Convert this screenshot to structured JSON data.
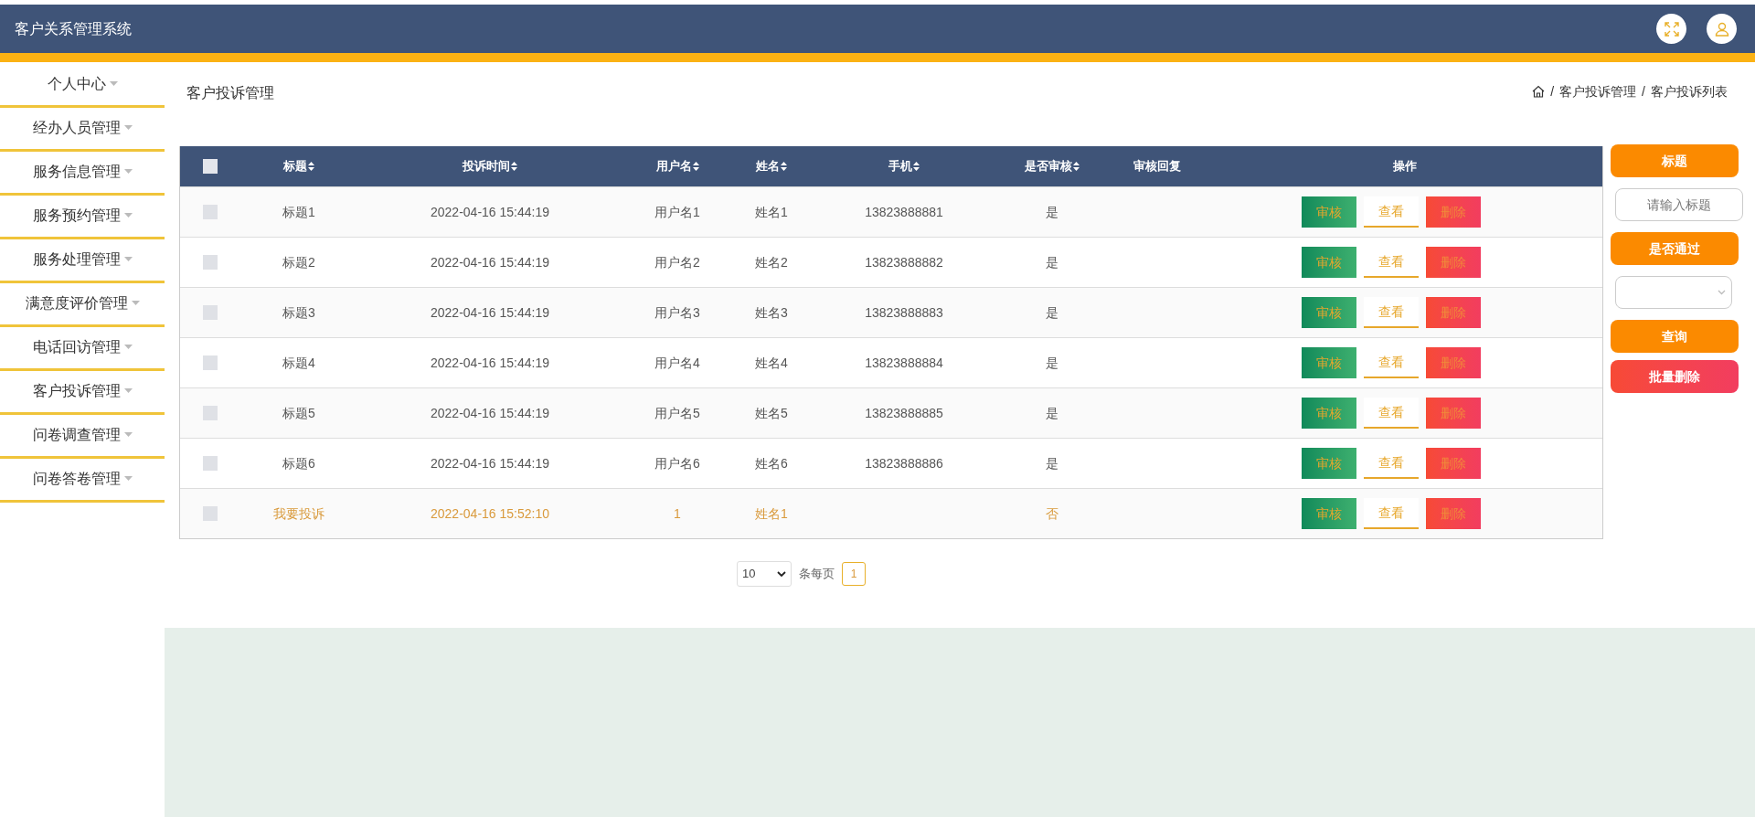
{
  "header": {
    "title": "客户关系管理系统"
  },
  "sidebar": {
    "items": [
      {
        "label": "个人中心"
      },
      {
        "label": "经办人员管理"
      },
      {
        "label": "服务信息管理"
      },
      {
        "label": "服务预约管理"
      },
      {
        "label": "服务处理管理"
      },
      {
        "label": "满意度评价管理"
      },
      {
        "label": "电话回访管理"
      },
      {
        "label": "客户投诉管理"
      },
      {
        "label": "问卷调查管理"
      },
      {
        "label": "问卷答卷管理"
      }
    ]
  },
  "page_title": "客户投诉管理",
  "breadcrumb": [
    {
      "separator": "/",
      "label": "客户投诉管理"
    },
    {
      "separator": "/",
      "label": "客户投诉列表"
    }
  ],
  "table": {
    "select_all": {
      "checked": false
    },
    "columns": [
      {
        "label": "标题",
        "sortable": true
      },
      {
        "label": "投诉时间",
        "sortable": true
      },
      {
        "label": "用户名",
        "sortable": true
      },
      {
        "label": "姓名",
        "sortable": true
      },
      {
        "label": "手机",
        "sortable": true
      },
      {
        "label": "是否审核",
        "sortable": true
      },
      {
        "label": "审核回复",
        "sortable": false
      },
      {
        "label": "操作",
        "sortable": false
      }
    ],
    "rows": [
      {
        "checked": false,
        "highlighted": false,
        "cells": [
          "标题1",
          "2022-04-16 15:44:19",
          "用户名1",
          "姓名1",
          "13823888881",
          "是",
          ""
        ],
        "actions": [
          "审核",
          "查看",
          "删除"
        ]
      },
      {
        "checked": false,
        "highlighted": false,
        "cells": [
          "标题2",
          "2022-04-16 15:44:19",
          "用户名2",
          "姓名2",
          "13823888882",
          "是",
          ""
        ],
        "actions": [
          "审核",
          "查看",
          "删除"
        ]
      },
      {
        "checked": false,
        "highlighted": false,
        "cells": [
          "标题3",
          "2022-04-16 15:44:19",
          "用户名3",
          "姓名3",
          "13823888883",
          "是",
          ""
        ],
        "actions": [
          "审核",
          "查看",
          "删除"
        ]
      },
      {
        "checked": false,
        "highlighted": false,
        "cells": [
          "标题4",
          "2022-04-16 15:44:19",
          "用户名4",
          "姓名4",
          "13823888884",
          "是",
          ""
        ],
        "actions": [
          "审核",
          "查看",
          "删除"
        ]
      },
      {
        "checked": false,
        "highlighted": false,
        "cells": [
          "标题5",
          "2022-04-16 15:44:19",
          "用户名5",
          "姓名5",
          "13823888885",
          "是",
          ""
        ],
        "actions": [
          "审核",
          "查看",
          "删除"
        ]
      },
      {
        "checked": false,
        "highlighted": false,
        "cells": [
          "标题6",
          "2022-04-16 15:44:19",
          "用户名6",
          "姓名6",
          "13823888886",
          "是",
          ""
        ],
        "actions": [
          "审核",
          "查看",
          "删除"
        ]
      },
      {
        "checked": false,
        "highlighted": true,
        "cells": [
          "我要投诉",
          "2022-04-16 15:52:10",
          "1",
          "姓名1",
          "",
          "否",
          ""
        ],
        "actions": [
          "审核",
          "查看",
          "删除"
        ]
      }
    ]
  },
  "pagination": {
    "page_size": "10",
    "per_page_label": "条每页",
    "pages": [
      {
        "label": "1",
        "selected": true
      }
    ]
  },
  "filters": {
    "title_label": "标题",
    "title_placeholder": "请输入标题",
    "pass_label": "是否通过",
    "search_button": "查询",
    "batch_delete_button": "批量删除"
  }
}
